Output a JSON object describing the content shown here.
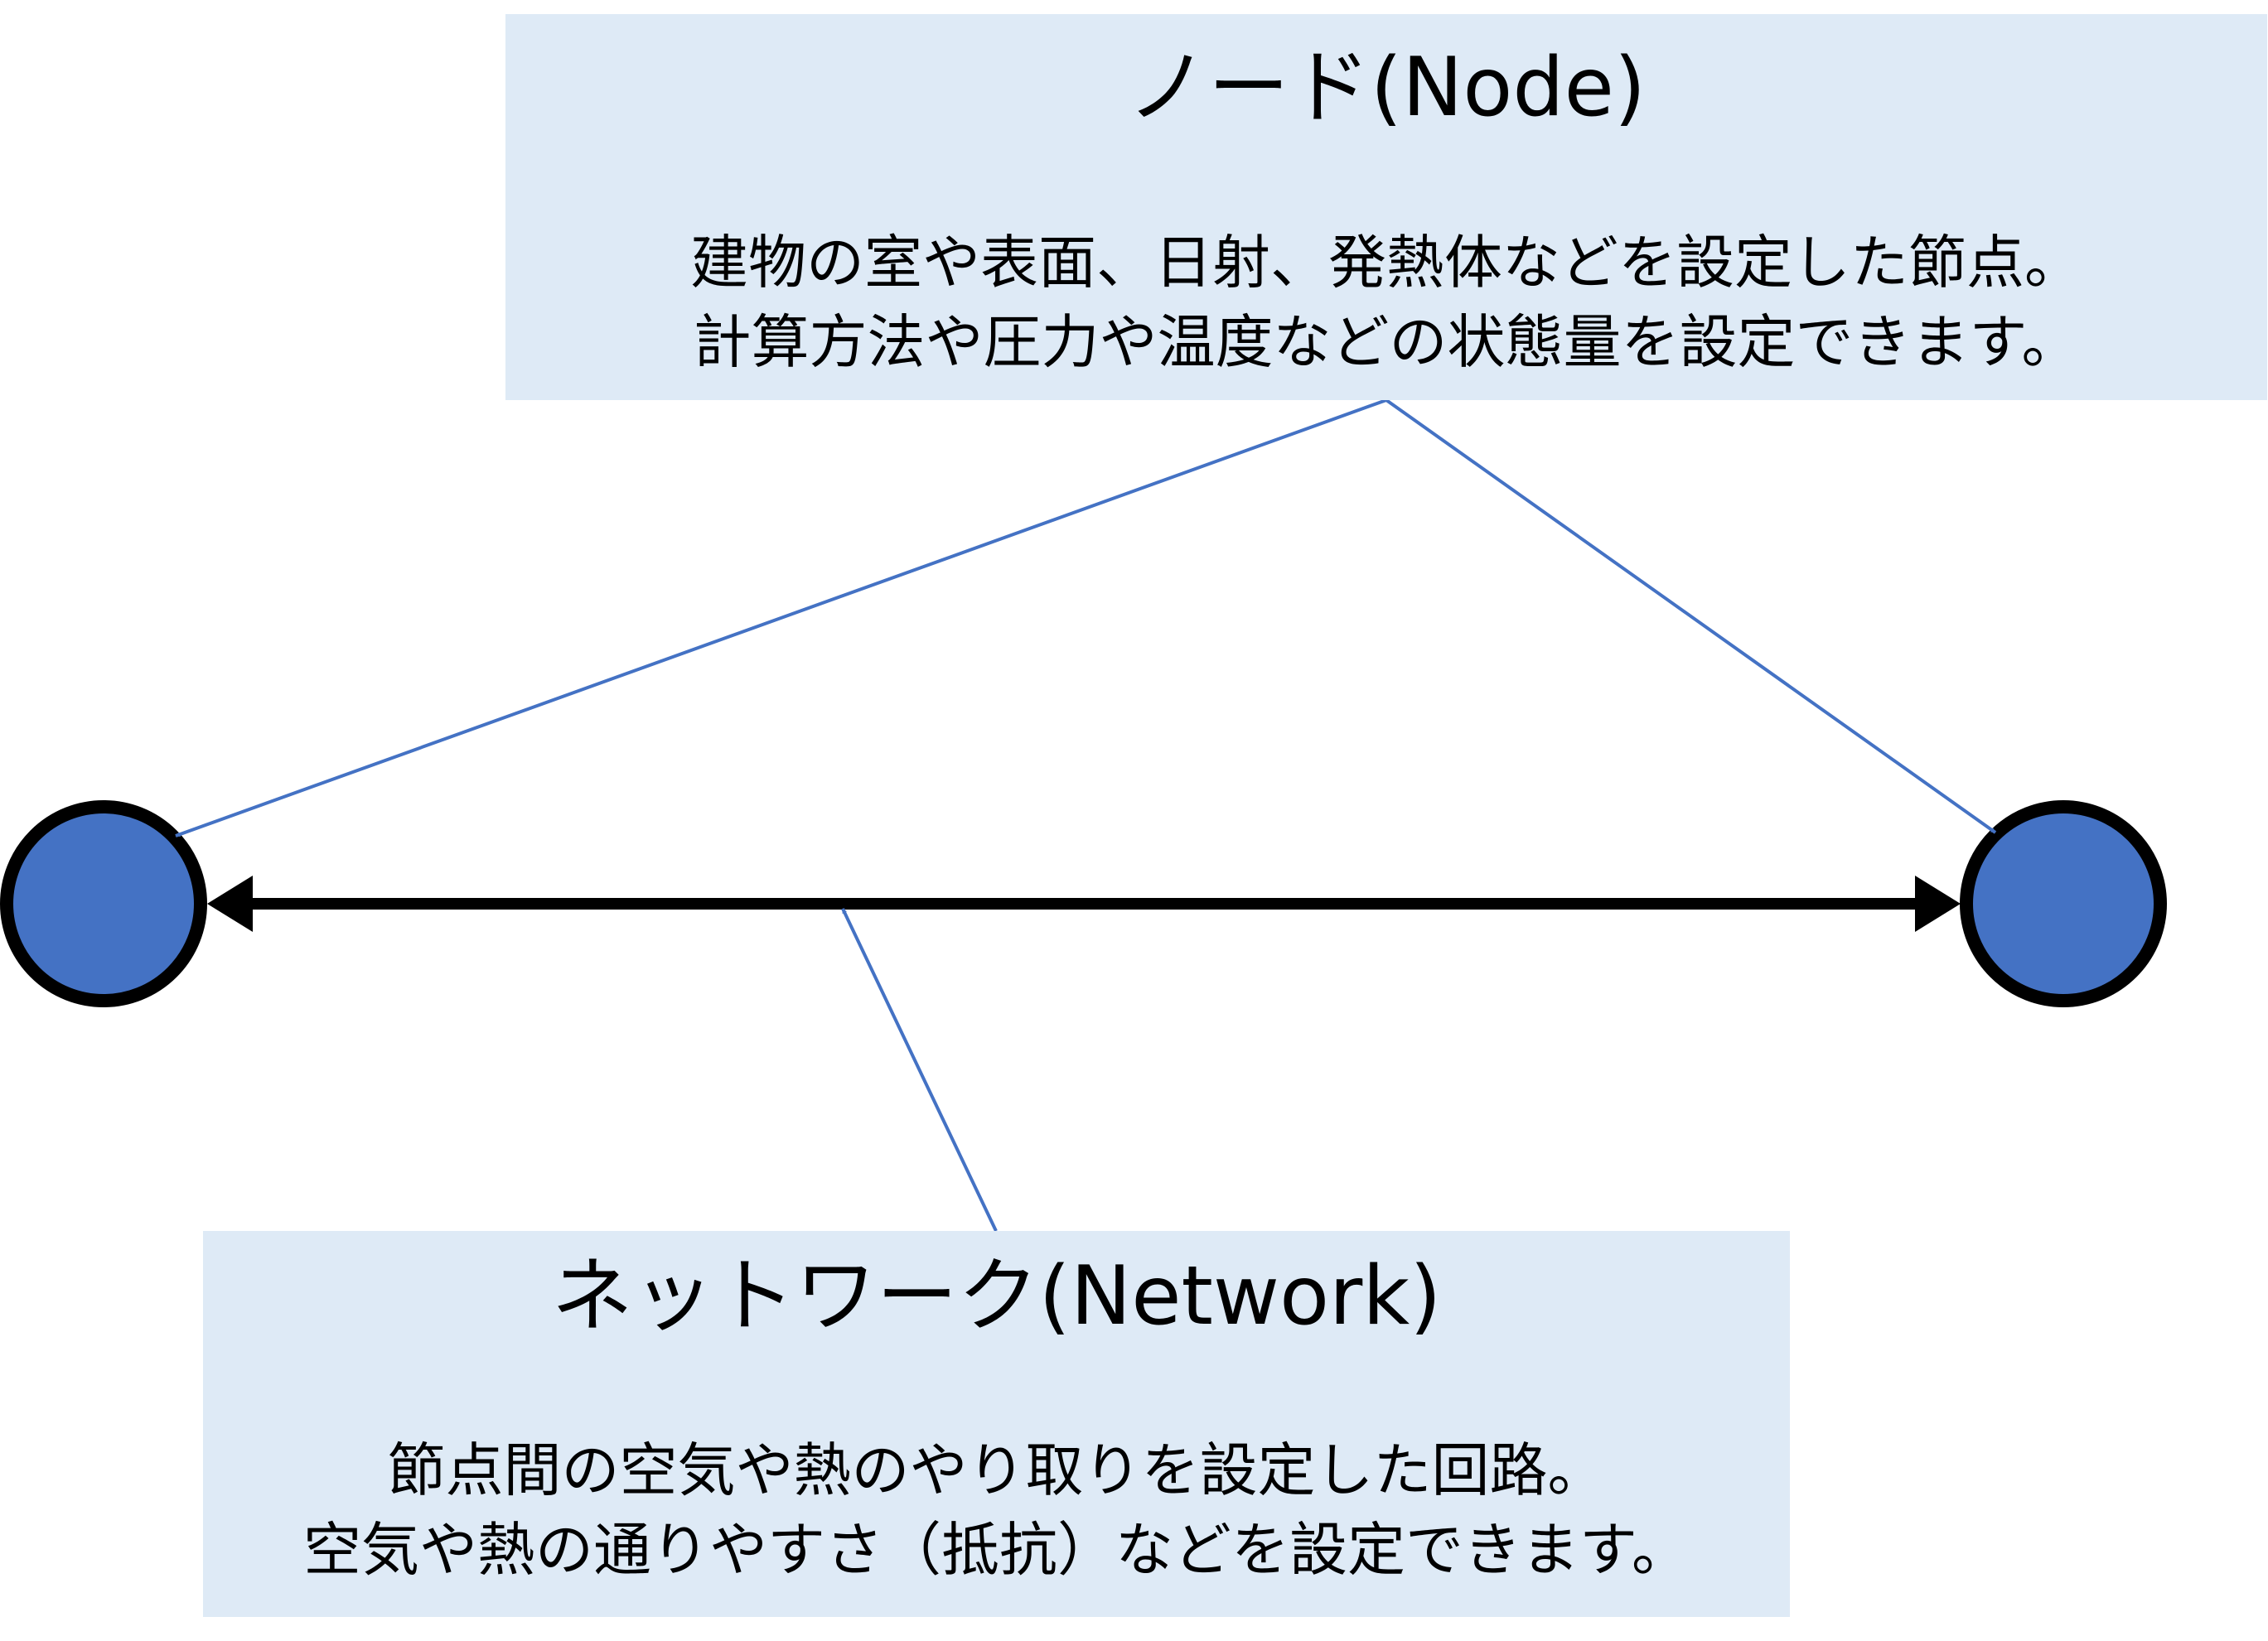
{
  "node_callout": {
    "title": "ノード(Node)",
    "lines": [
      "建物の室や表面、日射、発熱体などを設定した節点。",
      "計算方法や圧力や温度などの状態量を設定できます。"
    ]
  },
  "network_callout": {
    "title": "ネットワーク(Network)",
    "lines": [
      "節点間の空気や熱のやり取りを設定した回路。",
      "空気や熱の通りやすさ（抵抗）などを設定できます。"
    ]
  },
  "colors": {
    "callout_fill": "#deeaf6",
    "node_fill": "#4472c4",
    "node_stroke": "#000000",
    "pointer_line": "#4472c4",
    "network_line": "#000000"
  }
}
